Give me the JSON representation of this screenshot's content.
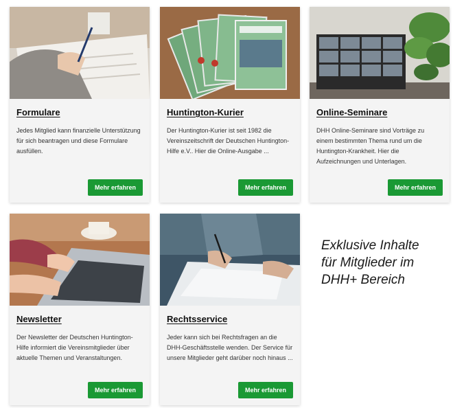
{
  "cards": [
    {
      "title": "Formulare",
      "description": "Jedes Mitglied kann finanzielle Unterstützung für sich beantragen und diese Formulare ausfüllen.",
      "button_label": "Mehr erfahren"
    },
    {
      "title": "Huntington-Kurier",
      "description": "Der Huntington-Kurier ist seit 1982 die Vereinszeitschrift der Deutschen Huntington-Hilfe e.V.. Hier die Online-Ausgabe ...",
      "button_label": "Mehr erfahren"
    },
    {
      "title": "Online-Seminare",
      "description": "DHH Online-Seminare sind Vorträge zu einem bestimmten Thema rund um die Huntington-Krankheit. Hier die Aufzeichnungen und Unterlagen.",
      "button_label": "Mehr erfahren"
    },
    {
      "title": "Newsletter",
      "description": "Der Newsletter der Deutschen Huntington-Hilfe informiert die Vereinsmitglieder über aktuelle Themen und Veranstaltungen.",
      "button_label": "Mehr erfahren"
    },
    {
      "title": "Rechtsservice",
      "description": "Jeder kann sich bei Rechtsfragen an die DHH-Geschäftsstelle wenden. Der Service für unsere Mitglieder geht darüber noch hinaus ...",
      "button_label": "Mehr erfahren"
    }
  ],
  "promo": {
    "line1": "Exklusive Inhalte",
    "line2": "für Mitglieder im",
    "line3": "DHH+ Bereich"
  },
  "colors": {
    "button": "#1a9934",
    "card_background": "#f4f4f4"
  }
}
